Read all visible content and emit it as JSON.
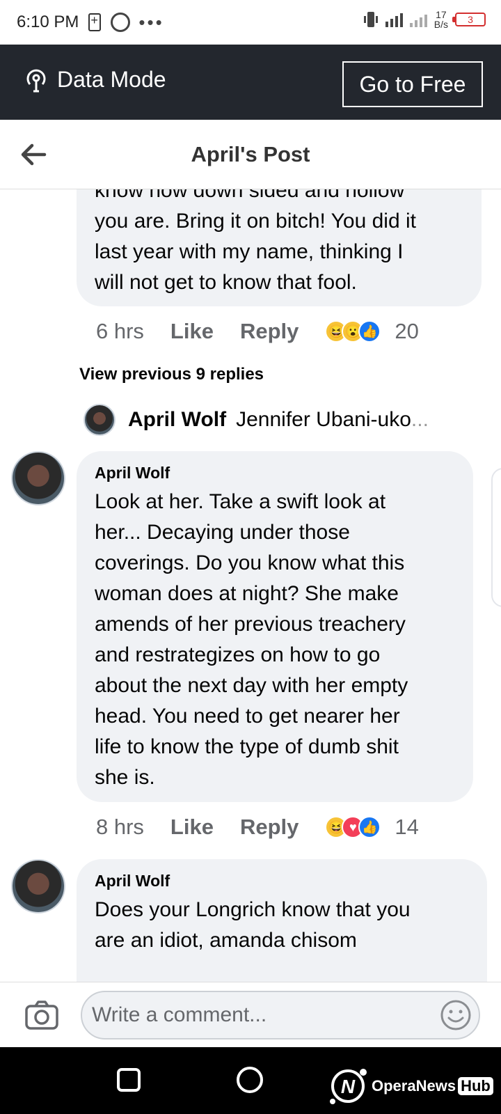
{
  "status_bar": {
    "time": "6:10 PM",
    "net_rate_value": "17",
    "net_rate_unit": "B/s",
    "battery_level": "3",
    "icons": [
      "battery-saver-icon",
      "swirl-app-icon",
      "more-dots-icon",
      "vibrate-icon",
      "signal-icon",
      "battery-icon"
    ]
  },
  "data_mode": {
    "label": "Data Mode",
    "go_free_label": "Go to Free"
  },
  "header": {
    "title": "April's Post"
  },
  "comment_top": {
    "lines": [
      "know how down sided and hollow",
      "you are.  Bring it on bitch!  You did it",
      "last year with my name,  thinking I",
      "will not get to know that fool."
    ],
    "meta": {
      "time": "6 hrs",
      "like": "Like",
      "reply": "Reply",
      "count": "20",
      "reactions": [
        "haha",
        "wow",
        "like"
      ]
    }
  },
  "view_previous": "View previous 9 replies",
  "reply_preview": {
    "name": "April Wolf",
    "snippet": "Jennifer Ubani-uko",
    "ellipsis": "..."
  },
  "comment_2": {
    "author": "April Wolf",
    "lines": [
      "Look at her.  Take a swift look at",
      "her... Decaying under those",
      "coverings.  Do you know what this",
      "woman does at night?  She make",
      "amends of her previous  treachery",
      "and restrategizes on how to go",
      "about the next day with her empty",
      "head. You need to get nearer her",
      "life to know the type of dumb shit",
      "she is."
    ],
    "meta": {
      "time": "8 hrs",
      "like": "Like",
      "reply": "Reply",
      "count": "14",
      "reactions": [
        "haha",
        "love",
        "like"
      ]
    }
  },
  "comment_3": {
    "author": "April Wolf",
    "lines": [
      "Does your Longrich know that you",
      "are an idiot,  amanda chisom"
    ]
  },
  "composer": {
    "placeholder": "Write a comment..."
  },
  "watermark": {
    "text": "OperaNews",
    "badge": "Hub"
  },
  "colors": {
    "data_bar": "#23272e",
    "bubble": "#f0f2f5",
    "meta_text": "#65676b",
    "like_blue": "#1877f2",
    "haha_yellow": "#f7c336",
    "love_red": "#f33e58",
    "battery_red": "#d32f2f"
  }
}
